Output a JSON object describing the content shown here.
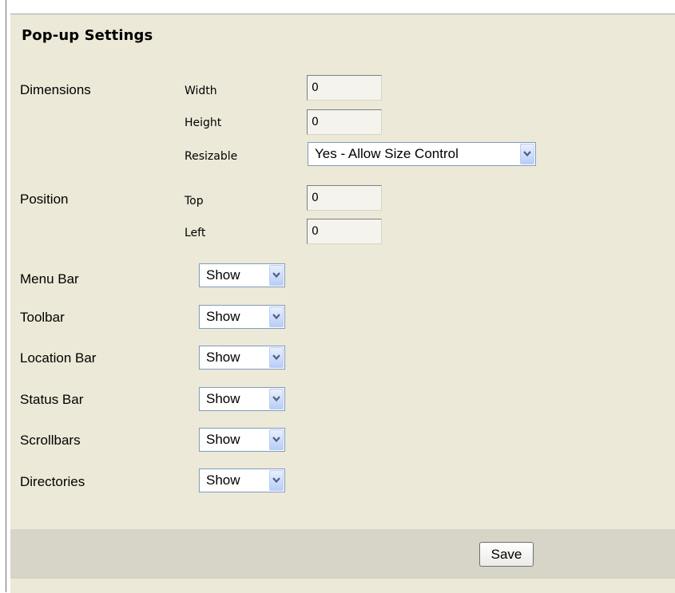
{
  "section_title": "Pop-up Settings",
  "dimensions": {
    "label": "Dimensions",
    "width_label": "Width",
    "width_value": "0",
    "height_label": "Height",
    "height_value": "0",
    "resizable_label": "Resizable",
    "resizable_value": "Yes - Allow Size Control"
  },
  "position": {
    "label": "Position",
    "top_label": "Top",
    "top_value": "0",
    "left_label": "Left",
    "left_value": "0"
  },
  "toggles": [
    {
      "label": "Menu Bar",
      "value": "Show"
    },
    {
      "label": "Toolbar",
      "value": "Show"
    },
    {
      "label": "Location Bar",
      "value": "Show"
    },
    {
      "label": "Status Bar",
      "value": "Show"
    },
    {
      "label": "Scrollbars",
      "value": "Show"
    },
    {
      "label": "Directories",
      "value": "Show"
    }
  ],
  "save_label": "Save",
  "colors": {
    "panel_bg": "#ece9d8",
    "footer_bg": "#d7d4c8",
    "select_border": "#7f9db9",
    "arrow_color": "#4d6185"
  },
  "icons": {
    "dropdown_arrow": "chevron-down-icon"
  }
}
